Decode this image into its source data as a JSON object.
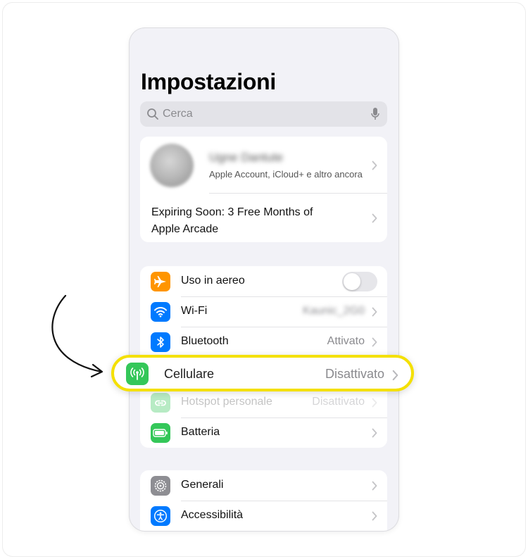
{
  "settings": {
    "title": "Impostazioni",
    "search": {
      "placeholder": "Cerca"
    },
    "account": {
      "name": "Ugne Dantute",
      "subtitle": "Apple Account, iCloud+ e altro ancora",
      "promo": "Expiring Soon: 3 Free Months of Apple Arcade"
    },
    "connectivity": [
      {
        "label": "Uso in aereo",
        "icon": "airplane-icon",
        "color": "#ff9500",
        "toggle": false
      },
      {
        "label": "Wi-Fi",
        "icon": "wifi-icon",
        "color": "#007aff",
        "value": "Kaunic_2G0"
      },
      {
        "label": "Bluetooth",
        "icon": "bluetooth-icon",
        "color": "#007aff",
        "value": "Attivato"
      },
      {
        "label": "Cellulare",
        "icon": "antenna-icon",
        "color": "#34c759",
        "value": "Disattivato"
      },
      {
        "label": "Hotspot personale",
        "icon": "hotspot-icon",
        "color": "#34c759",
        "value": "Disattivato"
      },
      {
        "label": "Batteria",
        "icon": "battery-icon",
        "color": "#34c759"
      }
    ],
    "general": [
      {
        "label": "Generali",
        "icon": "gear-icon",
        "color": "#8e8e93"
      },
      {
        "label": "Accessibilità",
        "icon": "accessibility-icon",
        "color": "#007aff"
      }
    ]
  },
  "highlight": {
    "label": "Cellulare",
    "value": "Disattivato",
    "border_color": "#f4e000"
  },
  "colors": {
    "accent_blue": "#007aff",
    "orange": "#ff9500",
    "green": "#34c759",
    "gray": "#8e8e93",
    "grouped_background": "#f2f2f7"
  }
}
